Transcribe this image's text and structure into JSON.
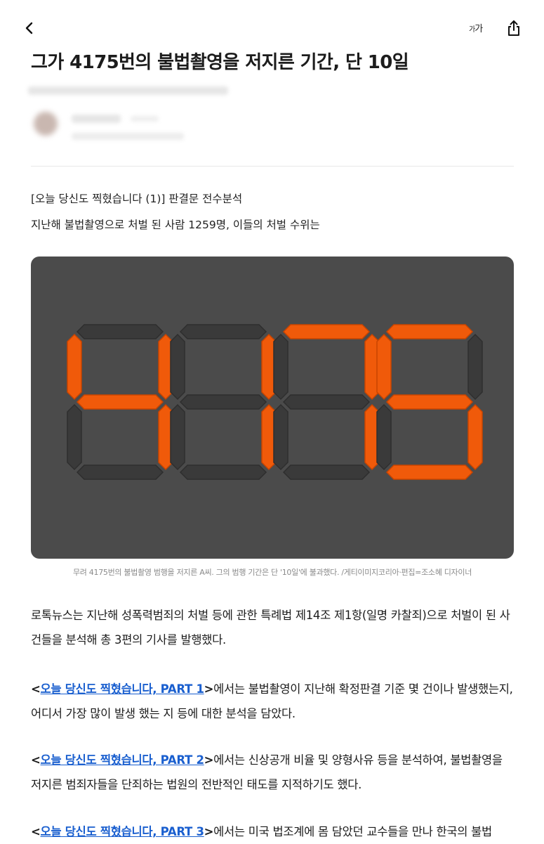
{
  "header": {
    "back_icon": "chevron-left-icon",
    "font_size_label_small": "가",
    "font_size_label_large": "가",
    "share_icon": "share-icon"
  },
  "article": {
    "title": "그가 4175번의 불법촬영을 저지른 기간, 단 10일",
    "subhead_1": "[오늘 당신도 찍혔습니다 (1)] 판결문 전수분석",
    "subhead_2": "지난해 불법촬영으로 처벌 된 사람 1259명, 이들의 처벌 수위는",
    "hero": {
      "display_number": "4175",
      "segment_on_color": "#f05a0a",
      "segment_off_color": "#3a3a3a",
      "background": "#4b4b4b"
    },
    "caption": "무려 4175번의 불법촬영 범행을 저지른 A씨. 그의 범행 기간은 단 '10일'에 불과했다. /게티이미지코리아·편집=조소혜 디자이너",
    "paragraphs": [
      {
        "text": "로톡뉴스는 지난해 성폭력범죄의 처벌 등에 관한 특례법 제14조 제1항(일명 카찰죄)으로 처벌이 된 사건들을 분석해 총 3편의 기사를 발행했다."
      },
      {
        "bracket_open": "<",
        "link": "오늘 당신도 찍혔습니다, PART 1",
        "bracket_close": ">",
        "text": "에서는 불법촬영이 지난해 확정판결 기준 몇 건이나 발생했는지, 어디서 가장 많이 발생 했는 지 등에 대한 분석을 담았다."
      },
      {
        "bracket_open": "<",
        "link": "오늘 당신도 찍혔습니다, PART 2",
        "bracket_close": ">",
        "text": "에서는 신상공개 비율 및 양형사유 등을 분석하여, 불법촬영을 저지른 범죄자들을 단죄하는 법원의 전반적인 태도를 지적하기도 했다."
      },
      {
        "bracket_open": "<",
        "link": "오늘 당신도 찍혔습니다, PART 3",
        "bracket_close": ">",
        "text": "에서는 미국 법조계에 몸 담았던 교수들을 만나 한국의 불법"
      }
    ]
  }
}
